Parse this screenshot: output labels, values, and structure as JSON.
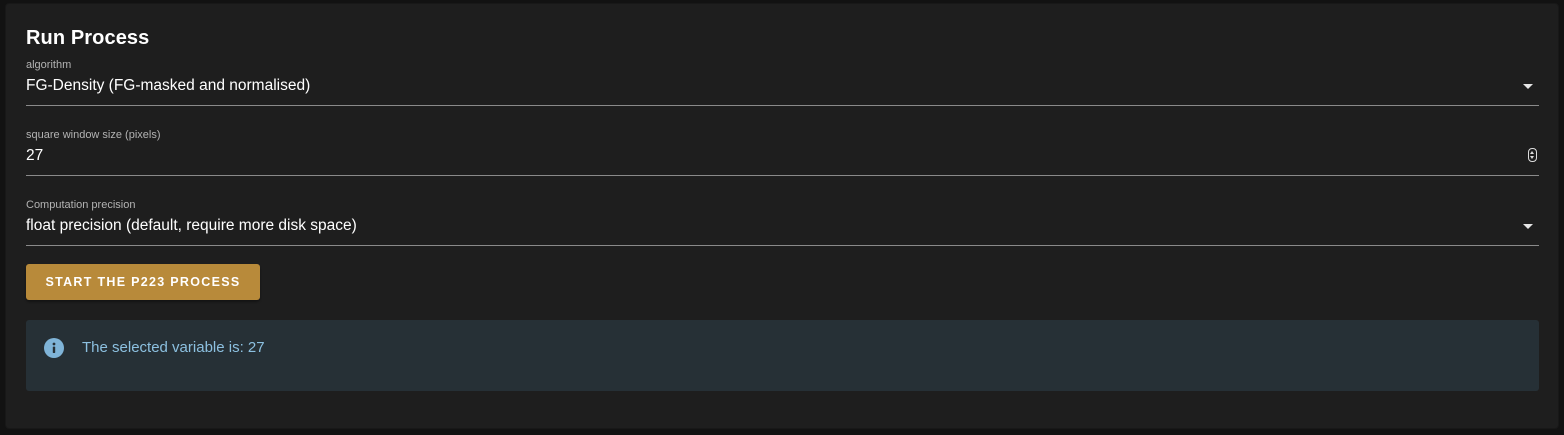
{
  "panel": {
    "title": "Run Process"
  },
  "algorithm": {
    "label": "algorithm",
    "value": "FG-Density (FG-masked and normalised)"
  },
  "window_size": {
    "label": "square window size (pixels)",
    "value": "27"
  },
  "precision": {
    "label": "Computation precision",
    "value": "float precision (default, require more disk space)"
  },
  "start_button": {
    "label": "START THE P223 PROCESS"
  },
  "alert": {
    "icon": "info-icon",
    "message": "The selected variable is: 27"
  },
  "colors": {
    "background": "#1e1e1e",
    "button": "#b88a3a",
    "alert_background": "#263036",
    "alert_text": "#8cc0e0"
  }
}
